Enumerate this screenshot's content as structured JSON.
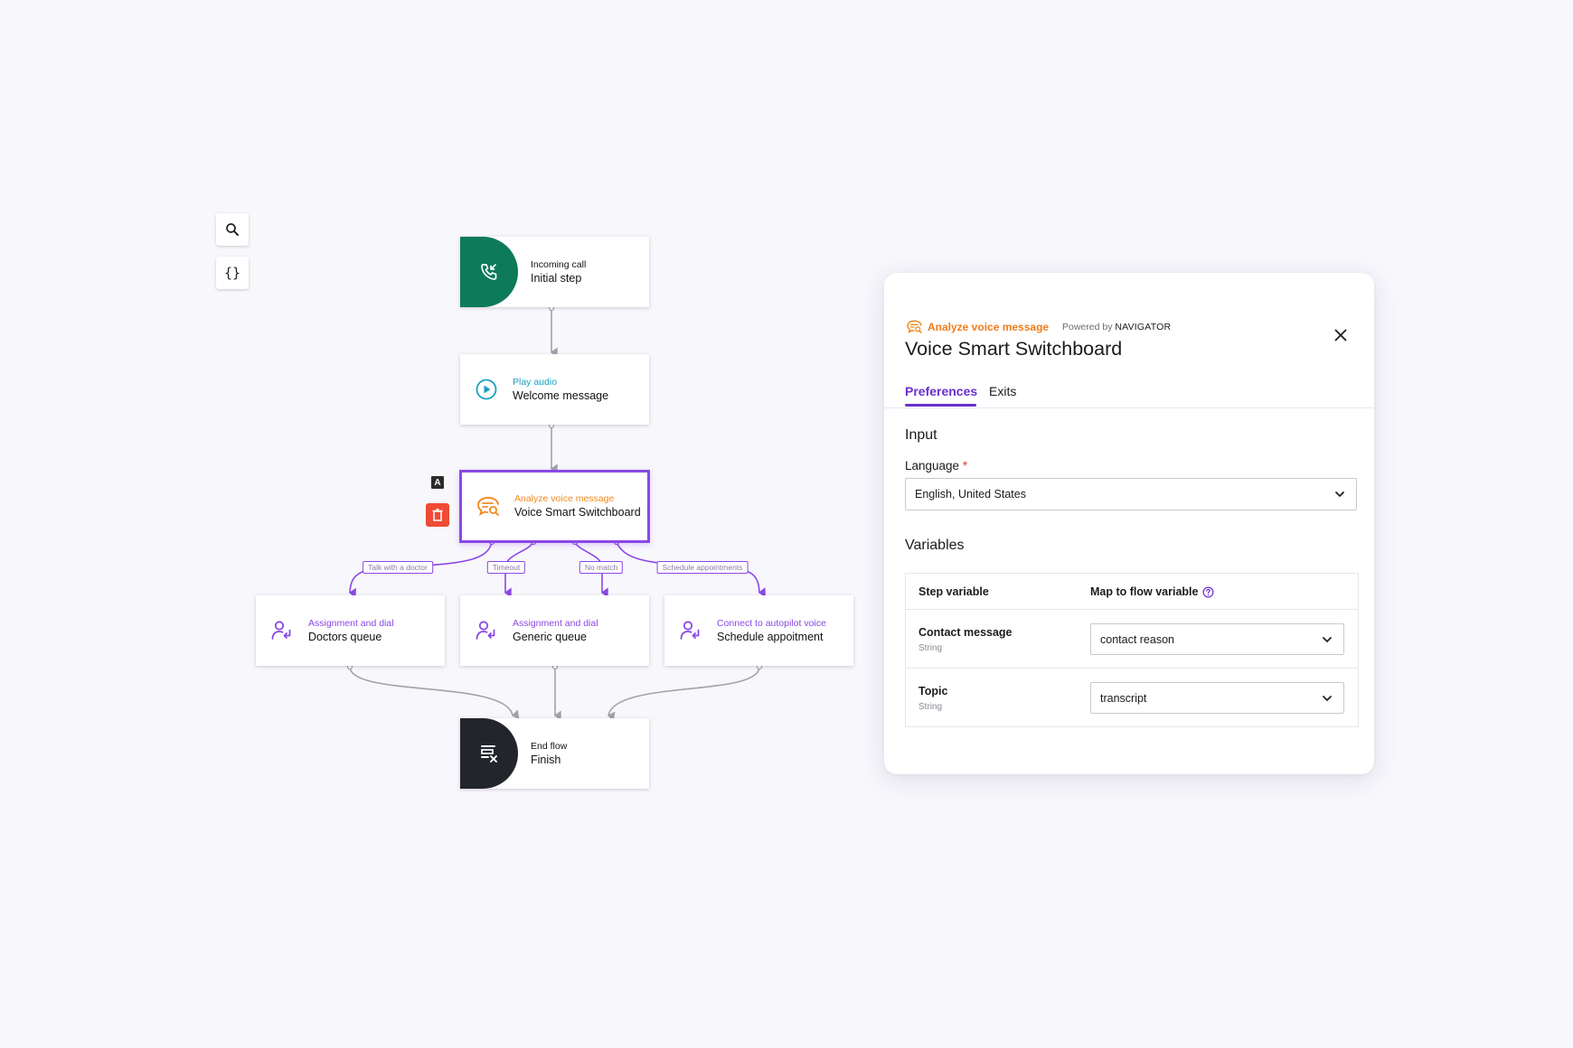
{
  "toolbar": {
    "search_icon": "search-icon",
    "braces": "{}"
  },
  "flow": {
    "start": {
      "type": "Incoming call",
      "name": "Initial step",
      "color": "#0d7a5a"
    },
    "play": {
      "type": "Play audio",
      "name": "Welcome message",
      "color": "#17a0c4"
    },
    "analyze": {
      "type": "Analyze voice message",
      "name": "Voice Smart Switchboard",
      "color": "#f28a1e"
    },
    "branch_labels": [
      "Talk with a doctor",
      "Timeout",
      "No match",
      "Schedule appointments"
    ],
    "doctors": {
      "type": "Assignment and dial",
      "name": "Doctors queue",
      "color": "#8a48e6"
    },
    "generic": {
      "type": "Assignment and dial",
      "name": "Generic queue",
      "color": "#8a48e6"
    },
    "autopilot": {
      "type": "Connect to autopilot voice",
      "name": "Schedule appoitment",
      "color": "#8a48e6"
    },
    "end": {
      "type": "End flow",
      "name": "Finish",
      "color": "#22252c"
    },
    "node_badge": "A"
  },
  "panel": {
    "step_type": "Analyze voice message",
    "powered_by": "Powered by",
    "provider": "NAVIGATOR",
    "title": "Voice Smart Switchboard",
    "tabs": [
      "Preferences",
      "Exits"
    ],
    "active_tab": "Preferences",
    "input_heading": "Input",
    "language_label": "Language",
    "required_mark": "*",
    "language_value": "English, United States",
    "variables_heading": "Variables",
    "col_step_variable": "Step variable",
    "col_map_variable": "Map to flow variable",
    "rows": [
      {
        "name": "Contact message",
        "type": "String",
        "value": "contact reason"
      },
      {
        "name": "Topic",
        "type": "String",
        "value": "transcript"
      }
    ],
    "accent": "#6a2fcf"
  }
}
